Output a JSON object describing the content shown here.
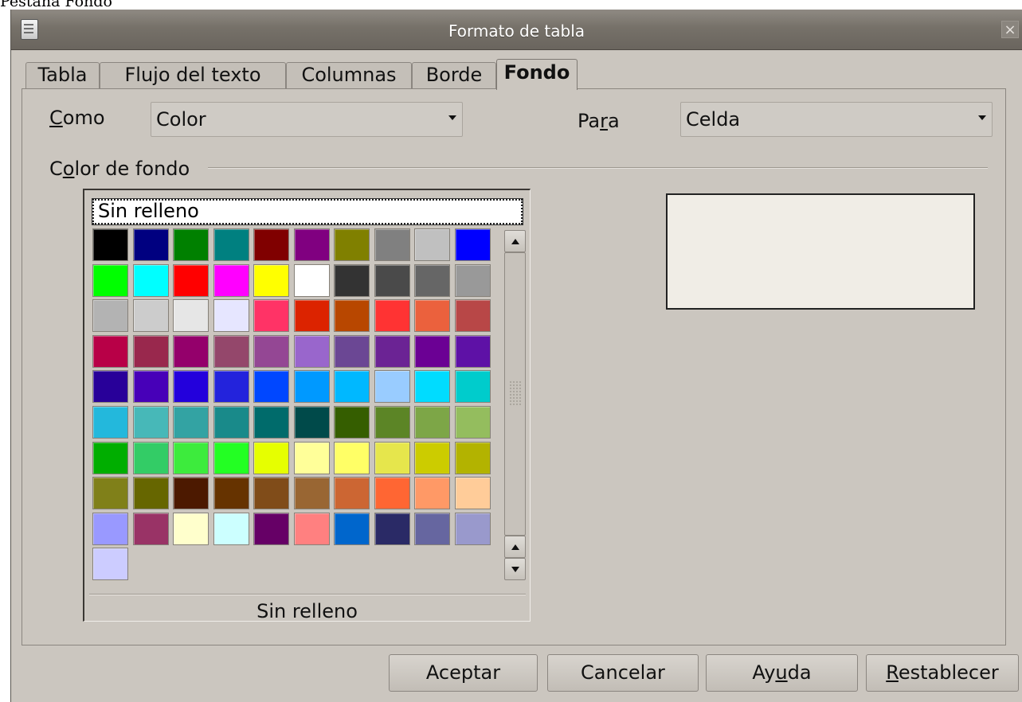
{
  "caption": "Pestaña Fondo",
  "window": {
    "title": "Formato de tabla",
    "close_glyph": "×"
  },
  "tabs": [
    {
      "label": "Tabla",
      "active": false
    },
    {
      "label": "Flujo del texto",
      "active": false
    },
    {
      "label": "Columnas",
      "active": false
    },
    {
      "label": "Borde",
      "active": false
    },
    {
      "label": "Fondo",
      "active": true
    }
  ],
  "fields": {
    "como": {
      "label_pre": "",
      "label_mnemonic": "C",
      "label_post": "omo",
      "value": "Color"
    },
    "para": {
      "label_pre": "Pa",
      "label_mnemonic": "r",
      "label_post": "a",
      "value": "Celda"
    }
  },
  "group": {
    "label_pre": "C",
    "label_mnemonic": "o",
    "label_post": "lor de fondo"
  },
  "palette": {
    "no_fill_label": "Sin relleno",
    "status": "Sin relleno",
    "colors": [
      "#000000",
      "#000080",
      "#008000",
      "#008080",
      "#800000",
      "#800080",
      "#808000",
      "#808080",
      "#c0c0c0",
      "#0000ff",
      "#00ff00",
      "#00ffff",
      "#ff0000",
      "#ff00ff",
      "#ffff00",
      "#ffffff",
      "#333333",
      "#4a4a4a",
      "#666666",
      "#999999",
      "#b3b3b3",
      "#cccccc",
      "#e6e6e6",
      "#e6e6ff",
      "#ff3366",
      "#dc2300",
      "#b84700",
      "#ff3333",
      "#eb613d",
      "#b84747",
      "#b80047",
      "#99284d",
      "#94006b",
      "#94476b",
      "#944794",
      "#9966cc",
      "#6b4794",
      "#6b2394",
      "#6b0094",
      "#5e11a6",
      "#280099",
      "#4700b8",
      "#2300dc",
      "#2323dc",
      "#0047ff",
      "#0099ff",
      "#00b8ff",
      "#99ccff",
      "#00dcff",
      "#00cccc",
      "#23b8dc",
      "#47b8b8",
      "#33a3a3",
      "#198a8a",
      "#006b6b",
      "#004a4a",
      "#355e00",
      "#5c8526",
      "#7da647",
      "#94bd5e",
      "#00ae00",
      "#33cc66",
      "#3deb3d",
      "#23ff23",
      "#e6ff00",
      "#ffff99",
      "#ffff66",
      "#e6e64c",
      "#cccc00",
      "#b3b300",
      "#808019",
      "#666600",
      "#4c1900",
      "#663300",
      "#804c19",
      "#996633",
      "#cc6633",
      "#ff6633",
      "#ff9966",
      "#ffcc99",
      "#9999ff",
      "#993366",
      "#ffffcc",
      "#ccffff",
      "#660066",
      "#ff8080",
      "#0066cc",
      "#2a2a66",
      "#6666a0",
      "#9999cc",
      "#ccccff"
    ]
  },
  "preview": {
    "color": "#f0ede6"
  },
  "buttons": [
    {
      "name": "aceptar",
      "pre": "Aceptar",
      "mnemonic": "",
      "post": ""
    },
    {
      "name": "cancelar",
      "pre": "Cancelar",
      "mnemonic": "",
      "post": ""
    },
    {
      "name": "ayuda",
      "pre": "Ay",
      "mnemonic": "u",
      "post": "da"
    },
    {
      "name": "restablecer",
      "pre": "",
      "mnemonic": "R",
      "post": "establecer"
    }
  ]
}
